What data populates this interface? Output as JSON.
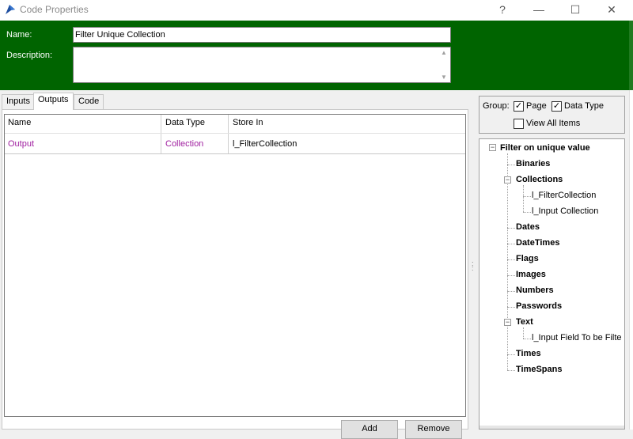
{
  "window": {
    "title": "Code Properties",
    "help_glyph": "?",
    "min_glyph": "—",
    "max_glyph": "☐",
    "close_glyph": "✕",
    "icon": "app-icon"
  },
  "header": {
    "name_label": "Name:",
    "name_value": "Filter Unique Collection",
    "description_label": "Description:",
    "description_value": "",
    "bg_color": "#006400"
  },
  "tabs": [
    {
      "label": "Inputs",
      "active": false
    },
    {
      "label": "Outputs",
      "active": true
    },
    {
      "label": "Code",
      "active": false
    }
  ],
  "grid": {
    "columns": [
      "Name",
      "Data Type",
      "Store In"
    ],
    "rows": [
      {
        "name": "Output",
        "data_type": "Collection",
        "store_in": "l_FilterCollection"
      }
    ],
    "accent_color": "#a020a0"
  },
  "buttons": {
    "add": "Add",
    "remove": "Remove"
  },
  "group": {
    "label": "Group:",
    "page": {
      "label": "Page",
      "checked": true
    },
    "data_type": {
      "label": "Data Type",
      "checked": true
    },
    "view_all": {
      "label": "View All Items",
      "checked": false
    }
  },
  "tree": {
    "root": "Filter on unique value",
    "items": [
      {
        "label": "Binaries"
      },
      {
        "label": "Collections",
        "children": [
          "l_FilterCollection",
          "l_Input Collection"
        ]
      },
      {
        "label": "Dates"
      },
      {
        "label": "DateTimes"
      },
      {
        "label": "Flags"
      },
      {
        "label": "Images"
      },
      {
        "label": "Numbers"
      },
      {
        "label": "Passwords"
      },
      {
        "label": "Text",
        "children": [
          "l_Input Field To be Filte"
        ]
      },
      {
        "label": "Times"
      },
      {
        "label": "TimeSpans"
      }
    ]
  }
}
